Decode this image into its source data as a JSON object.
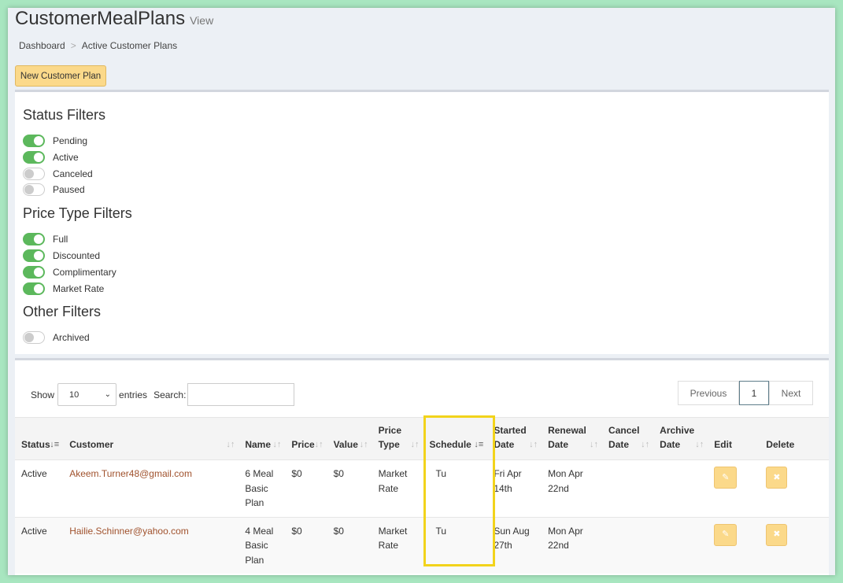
{
  "header": {
    "title": "CustomerMealPlans",
    "subtitle": "View"
  },
  "breadcrumb": {
    "items": [
      "Dashboard",
      "Active Customer Plans"
    ],
    "separator": ">"
  },
  "actions": {
    "new_plan_label": "New Customer Plan"
  },
  "filters": {
    "status": {
      "title": "Status Filters",
      "items": [
        {
          "label": "Pending",
          "on": true
        },
        {
          "label": "Active",
          "on": true
        },
        {
          "label": "Canceled",
          "on": false
        },
        {
          "label": "Paused",
          "on": false
        }
      ]
    },
    "price_type": {
      "title": "Price Type Filters",
      "items": [
        {
          "label": "Full",
          "on": true
        },
        {
          "label": "Discounted",
          "on": true
        },
        {
          "label": "Complimentary",
          "on": true
        },
        {
          "label": "Market Rate",
          "on": true
        }
      ]
    },
    "other": {
      "title": "Other Filters",
      "items": [
        {
          "label": "Archived",
          "on": false
        }
      ]
    }
  },
  "table_controls": {
    "show_label": "Show",
    "entries_value": "10",
    "entries_label": "entries",
    "search_label": "Search:",
    "search_value": "",
    "pager": {
      "previous": "Previous",
      "current": "1",
      "next": "Next"
    }
  },
  "table": {
    "columns": [
      {
        "label": "Status"
      },
      {
        "label": "Customer"
      },
      {
        "label": "Name"
      },
      {
        "label": "Price"
      },
      {
        "label": "Value"
      },
      {
        "label": "Price Type"
      },
      {
        "label": "Schedule"
      },
      {
        "label": "Started Date"
      },
      {
        "label": "Renewal Date"
      },
      {
        "label": "Cancel Date"
      },
      {
        "label": "Archive Date"
      },
      {
        "label": "Edit"
      },
      {
        "label": "Delete"
      }
    ],
    "rows": [
      {
        "status": "Active",
        "customer": "Akeem.Turner48@gmail.com",
        "name": "6 Meal Basic Plan",
        "price": "$0",
        "value": "$0",
        "price_type": "Market Rate",
        "schedule": "Tu",
        "started": "Fri Apr 14th",
        "renewal": "Mon Apr 22nd",
        "cancel": "",
        "archive": ""
      },
      {
        "status": "Active",
        "customer": "Hailie.Schinner@yahoo.com",
        "name": "4 Meal Basic Plan",
        "price": "$0",
        "value": "$0",
        "price_type": "Market Rate",
        "schedule": "Tu",
        "started": "Sun Aug 27th",
        "renewal": "Mon Apr 22nd",
        "cancel": "",
        "archive": ""
      }
    ]
  },
  "colors": {
    "accent_warning": "#fbd98a",
    "toggle_on": "#5cb85c",
    "link": "#a0522d",
    "highlight": "#f2d31b",
    "background": "#a8e6c0"
  },
  "icons": {
    "edit": "pencil-icon",
    "delete": "times-icon",
    "sort": "sort-icon"
  }
}
